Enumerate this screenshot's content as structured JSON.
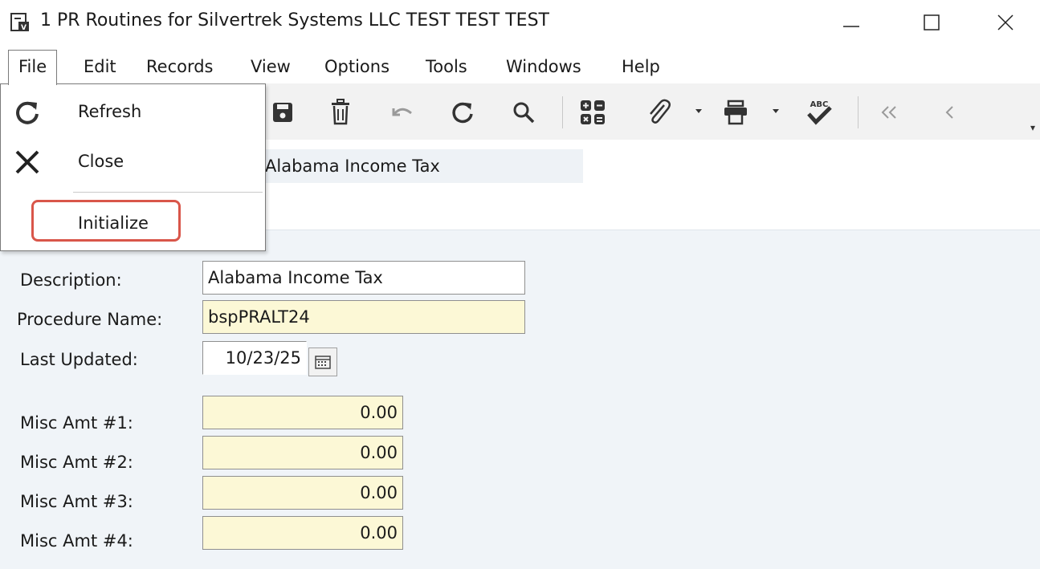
{
  "window": {
    "title": "1 PR Routines for Silvertrek Systems LLC TEST TEST TEST"
  },
  "menu": {
    "items": [
      "File",
      "Edit",
      "Records",
      "View",
      "Options",
      "Tools",
      "Windows",
      "Help"
    ]
  },
  "file_menu": {
    "items": [
      {
        "label": "Refresh",
        "icon": "refresh-icon"
      },
      {
        "label": "Close",
        "icon": "close-icon"
      },
      {
        "label": "Initialize",
        "icon": "",
        "highlighted": true
      }
    ]
  },
  "toolbar": {
    "icons": [
      "save-icon",
      "delete-icon",
      "undo-icon",
      "refresh-icon",
      "search-icon",
      "calculator-icon",
      "attachment-icon",
      "print-icon",
      "spellcheck-icon",
      "first-record-icon",
      "previous-record-icon"
    ]
  },
  "header": {
    "routine_description": "Alabama Income Tax"
  },
  "form": {
    "description_label": "Description:",
    "description_value": "Alabama Income Tax",
    "procedure_label": "Procedure Name:",
    "procedure_value": "bspPRALT24",
    "last_updated_label": "Last Updated:",
    "last_updated_value": "10/23/25",
    "misc": [
      {
        "label": "Misc Amt #1:",
        "value": "0.00"
      },
      {
        "label": "Misc Amt #2:",
        "value": "0.00"
      },
      {
        "label": "Misc Amt #3:",
        "value": "0.00"
      },
      {
        "label": "Misc Amt #4:",
        "value": "0.00"
      }
    ]
  },
  "colors": {
    "highlight": "#d9564a",
    "required_field": "#fcf8d6",
    "panel_bg": "#f0f4f8"
  }
}
